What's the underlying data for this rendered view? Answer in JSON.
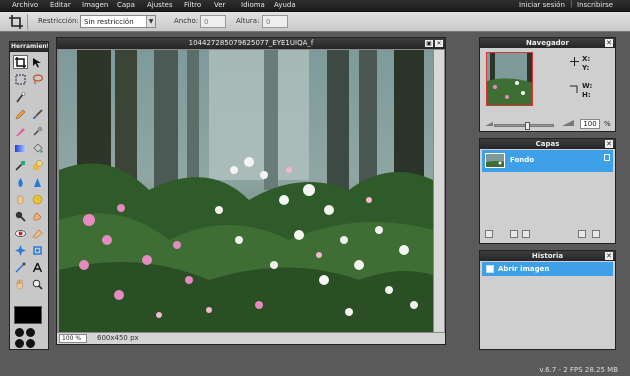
{
  "menubar": {
    "items": [
      "Archivo",
      "Editar",
      "Imagen",
      "Capa",
      "Ajustes",
      "Filtro",
      "Ver",
      "Idioma",
      "Ayuda"
    ],
    "login": "Iniciar sesión",
    "separator": "|",
    "signup": "Inscribirse"
  },
  "toolbar": {
    "restriction_label": "Restricción:",
    "restriction_value": "Sin restricción",
    "restriction_arrow": "▼",
    "width_label": "Ancho:",
    "width_value": "0",
    "height_label": "Altura:",
    "height_value": "0"
  },
  "tools": {
    "title": "Herramientas",
    "items": [
      "crop-icon",
      "move-icon",
      "marquee-icon",
      "lasso-icon",
      "wand-icon",
      "pencil-icon",
      "brush-icon",
      "clone-stamp-icon",
      "color-replace-icon",
      "drawing-icon",
      "gradient-icon",
      "paint-bucket-icon",
      "eraser-icon",
      "color-picker-icon",
      "blur-icon",
      "sharpen-icon",
      "smudge-icon",
      "sponge-icon",
      "dodge-icon",
      "burn-icon",
      "red-eye-icon",
      "spot-heal-icon",
      "bloat-icon",
      "pinch-icon",
      "type-icon",
      "hand-icon",
      "zoom-icon"
    ]
  },
  "image_window": {
    "title": "104427285079625077_EYE1UIQA_f",
    "zoom": "100 %",
    "dimensions": "600x450 px"
  },
  "navigator": {
    "title": "Navegador",
    "x_label": "X:",
    "y_label": "Y:",
    "w_label": "W:",
    "h_label": "H:",
    "zoom": "100",
    "zoom_unit": "%"
  },
  "layers": {
    "title": "Capas",
    "rows": [
      {
        "name": "Fondo"
      }
    ]
  },
  "history": {
    "title": "Historia",
    "rows": [
      {
        "label": "Abrir imagen"
      }
    ]
  },
  "status": {
    "version": "v.6.7 - 2 FPS 28.25 MB"
  },
  "colors": {
    "accent": "#3da0e8",
    "menubar": "#262626",
    "workspace": "#5a5a5a"
  }
}
